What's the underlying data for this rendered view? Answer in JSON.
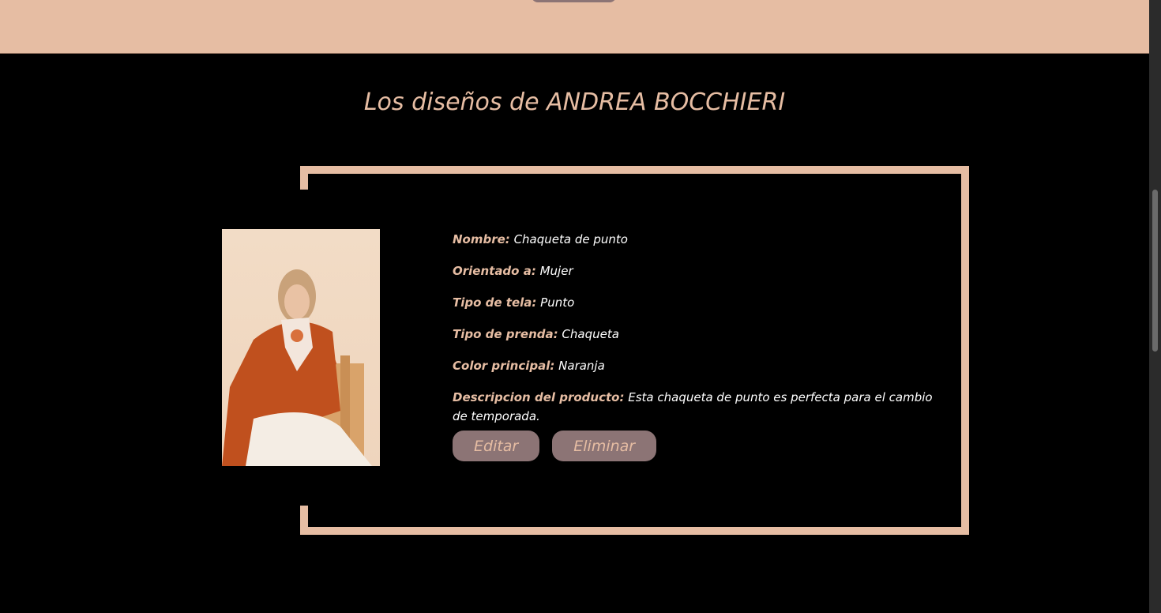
{
  "page": {
    "title": "Los diseños de ANDREA BOCCHIERI"
  },
  "product": {
    "fields": [
      {
        "label": "Nombre:",
        "value": "Chaqueta de punto"
      },
      {
        "label": "Orientado a:",
        "value": "Mujer"
      },
      {
        "label": "Tipo de tela:",
        "value": "Punto"
      },
      {
        "label": "Tipo de prenda:",
        "value": "Chaqueta"
      },
      {
        "label": "Color principal:",
        "value": "Naranja"
      },
      {
        "label": "Descripcion del producto:",
        "value": "Esta chaqueta de punto es perfecta para el cambio de temporada."
      }
    ],
    "edit_label": "Editar",
    "delete_label": "Eliminar"
  },
  "colors": {
    "accent": "#e6bda3",
    "button": "#8c7475",
    "background": "#000000"
  }
}
